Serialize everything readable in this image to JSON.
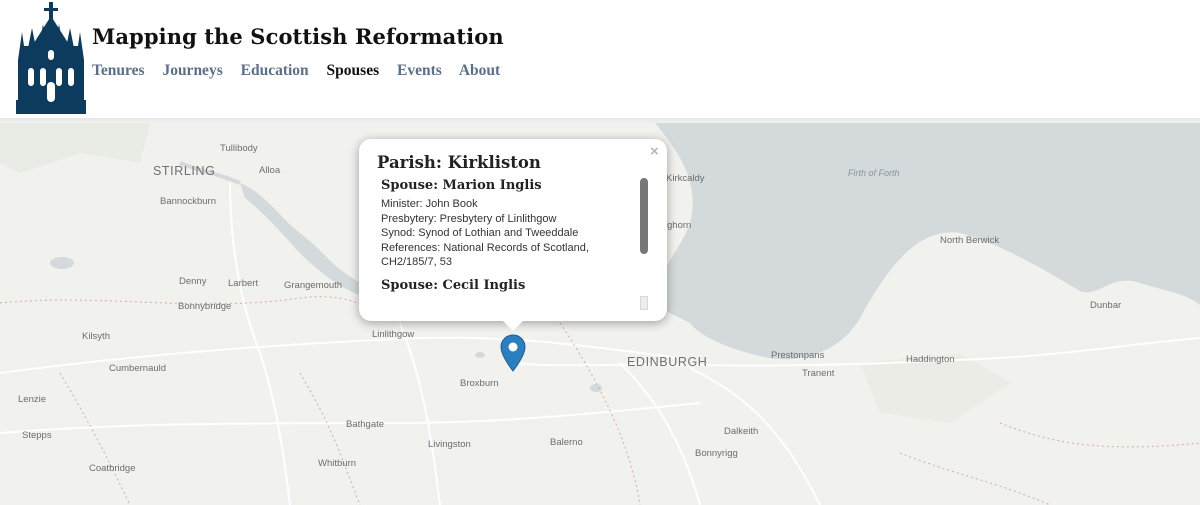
{
  "header": {
    "site_title": "Mapping the Scottish Reformation",
    "nav": [
      {
        "label": "Tenures",
        "active": false
      },
      {
        "label": "Journeys",
        "active": false
      },
      {
        "label": "Education",
        "active": false
      },
      {
        "label": "Spouses",
        "active": true
      },
      {
        "label": "Events",
        "active": false
      },
      {
        "label": "About",
        "active": false
      }
    ],
    "logo_icon": "cathedral-crown-spire-icon",
    "logo_color": "#0d3b5e"
  },
  "map": {
    "places": [
      {
        "name": "Tullibody",
        "type": "town"
      },
      {
        "name": "STIRLING",
        "type": "city"
      },
      {
        "name": "Alloa",
        "type": "town"
      },
      {
        "name": "Bannockburn",
        "type": "town"
      },
      {
        "name": "Kirkcaldy",
        "type": "town"
      },
      {
        "name": "Firth of Forth",
        "type": "water"
      },
      {
        "name": "ghorn",
        "type": "town"
      },
      {
        "name": "North Berwick",
        "type": "town"
      },
      {
        "name": "Denny",
        "type": "town"
      },
      {
        "name": "Larbert",
        "type": "town"
      },
      {
        "name": "Grangemouth",
        "type": "town"
      },
      {
        "name": "Bonnybridge",
        "type": "town"
      },
      {
        "name": "Dunbar",
        "type": "town"
      },
      {
        "name": "Kilsyth",
        "type": "town"
      },
      {
        "name": "Linlithgow",
        "type": "town"
      },
      {
        "name": "EDINBURGH",
        "type": "city"
      },
      {
        "name": "Prestonpans",
        "type": "town"
      },
      {
        "name": "Haddington",
        "type": "town"
      },
      {
        "name": "Tranent",
        "type": "town"
      },
      {
        "name": "Cumbernauld",
        "type": "town"
      },
      {
        "name": "Broxburn",
        "type": "town"
      },
      {
        "name": "Lenzie",
        "type": "town"
      },
      {
        "name": "Bathgate",
        "type": "town"
      },
      {
        "name": "Dalkeith",
        "type": "town"
      },
      {
        "name": "Stepps",
        "type": "town"
      },
      {
        "name": "Livingston",
        "type": "town"
      },
      {
        "name": "Balerno",
        "type": "town"
      },
      {
        "name": "Bonnyrigg",
        "type": "town"
      },
      {
        "name": "Coatbridge",
        "type": "town"
      },
      {
        "name": "Whitburn",
        "type": "town"
      }
    ],
    "marker_color": "#2a7fc0",
    "sea_color": "#d4dadc",
    "land_color": "#f1f1ee"
  },
  "popup": {
    "title": "Parish: Kirkliston",
    "close_label": "×",
    "spouses": [
      {
        "name": "Spouse: Marion Inglis",
        "minister": "Minister: John Book",
        "presbytery": "Presbytery: Presbytery of Linlithgow",
        "synod": "Synod: Synod of Lothian and Tweeddale",
        "references": "References: National Records of Scotland, CH2/185/7, 53"
      },
      {
        "name": "Spouse: Cecil Inglis"
      }
    ]
  }
}
